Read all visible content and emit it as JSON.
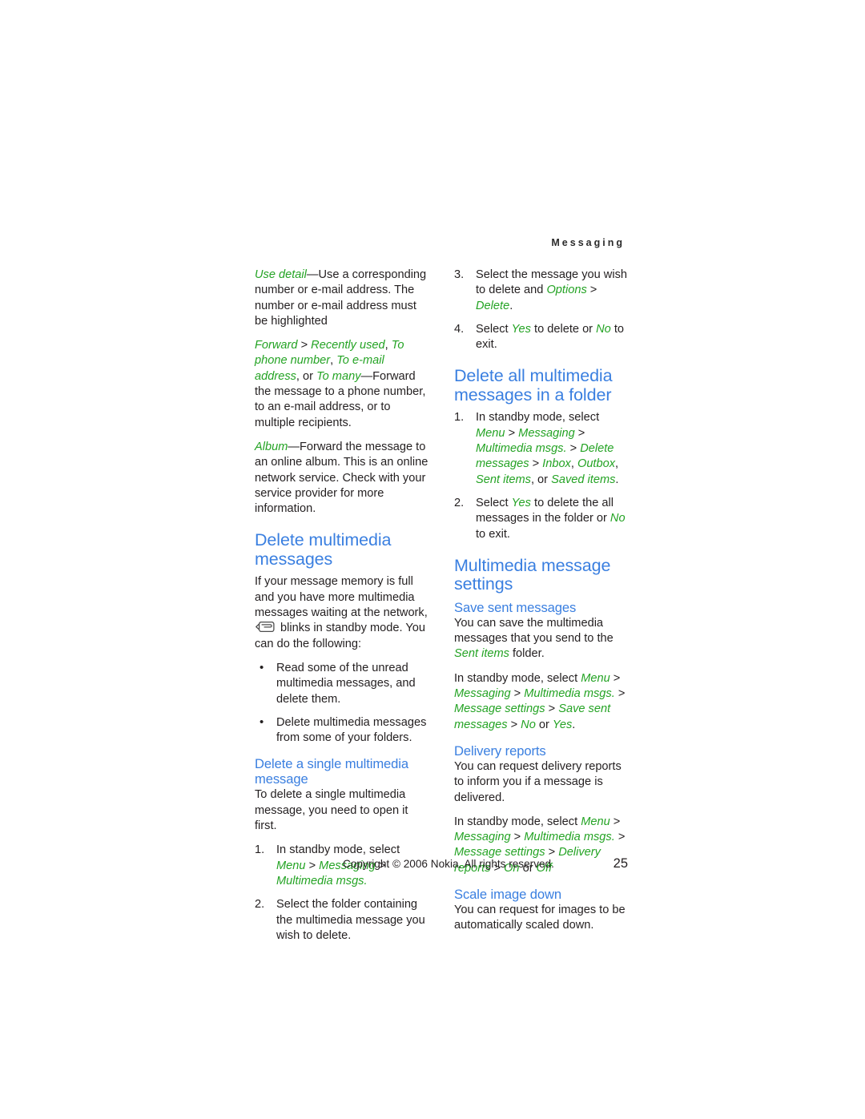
{
  "page": {
    "running_head": "Messaging",
    "page_number": "25",
    "copyright": "Copyright © 2006 Nokia. All rights reserved.",
    "colors": {
      "heading_blue": "#3a7fe0",
      "ui_string_green": "#24a324",
      "body_text": "#231f20",
      "background": "#ffffff"
    }
  },
  "left_column": {
    "paragraphs": [
      {
        "id": "use-detail",
        "runs": [
          {
            "text": "Use detail",
            "style": "green-italic"
          },
          {
            "text": "—Use a corresponding number or e-mail address. The number or e-mail address must be highlighted",
            "style": "body"
          }
        ]
      },
      {
        "id": "forward",
        "runs": [
          {
            "text": "Forward",
            "style": "green-italic"
          },
          {
            "text": " > ",
            "style": "body"
          },
          {
            "text": "Recently used",
            "style": "green-italic"
          },
          {
            "text": ", ",
            "style": "body"
          },
          {
            "text": "To phone number",
            "style": "green-italic"
          },
          {
            "text": ", ",
            "style": "body"
          },
          {
            "text": "To e-mail address",
            "style": "green-italic"
          },
          {
            "text": ", or ",
            "style": "body"
          },
          {
            "text": "To many",
            "style": "green-italic"
          },
          {
            "text": "—Forward the message to a phone number, to an e-mail address, or to multiple recipients.",
            "style": "body"
          }
        ]
      },
      {
        "id": "album",
        "runs": [
          {
            "text": "Album",
            "style": "green-italic"
          },
          {
            "text": "—Forward the message to an online album. This is an online network service. Check with your service provider for more information.",
            "style": "body"
          }
        ]
      }
    ],
    "delete_multimedia_messages": {
      "heading": "Delete multimedia messages",
      "intro_before_icon": "If your message memory is full and you have more multimedia messages waiting at the network, ",
      "icon": "message-envelope-icon",
      "intro_after_icon": " blinks in standby mode. You can do the following:",
      "bullets": [
        "Read some of the unread multimedia messages, and delete them.",
        "Delete multimedia messages from some of your folders."
      ]
    },
    "delete_single_multimedia_message": {
      "heading": "Delete a single multimedia message",
      "intro": "To delete a single multimedia message, you need to open it first.",
      "steps": [
        {
          "num": "1.",
          "runs": [
            {
              "text": "In standby mode, select ",
              "style": "body"
            },
            {
              "text": "Menu",
              "style": "green-italic"
            },
            {
              "text": " > ",
              "style": "body"
            },
            {
              "text": "Messaging",
              "style": "green-italic"
            },
            {
              "text": " > ",
              "style": "body"
            },
            {
              "text": "Multimedia msgs.",
              "style": "green-italic"
            }
          ]
        },
        {
          "num": "2.",
          "runs": [
            {
              "text": "Select the folder containing the multimedia message you wish to delete.",
              "style": "body"
            }
          ]
        }
      ]
    }
  },
  "right_column": {
    "continued_steps": [
      {
        "num": "3.",
        "runs": [
          {
            "text": "Select the message you wish to delete and ",
            "style": "body"
          },
          {
            "text": "Options",
            "style": "green-italic"
          },
          {
            "text": " > ",
            "style": "body"
          },
          {
            "text": "Delete",
            "style": "green-italic"
          },
          {
            "text": ".",
            "style": "body"
          }
        ]
      },
      {
        "num": "4.",
        "runs": [
          {
            "text": "Select ",
            "style": "body"
          },
          {
            "text": "Yes",
            "style": "green-italic"
          },
          {
            "text": " to delete or ",
            "style": "body"
          },
          {
            "text": "No",
            "style": "green-italic"
          },
          {
            "text": " to exit.",
            "style": "body"
          }
        ]
      }
    ],
    "delete_all_in_folder": {
      "heading": "Delete all multimedia messages in a folder",
      "steps": [
        {
          "num": "1.",
          "runs": [
            {
              "text": "In standby mode, select ",
              "style": "body"
            },
            {
              "text": "Menu",
              "style": "green-italic"
            },
            {
              "text": " > ",
              "style": "body"
            },
            {
              "text": "Messaging",
              "style": "green-italic"
            },
            {
              "text": " > ",
              "style": "body"
            },
            {
              "text": "Multimedia msgs.",
              "style": "green-italic"
            },
            {
              "text": " > ",
              "style": "body"
            },
            {
              "text": "Delete messages",
              "style": "green-italic"
            },
            {
              "text": " > ",
              "style": "body"
            },
            {
              "text": "Inbox",
              "style": "green-italic"
            },
            {
              "text": ", ",
              "style": "body"
            },
            {
              "text": "Outbox",
              "style": "green-italic"
            },
            {
              "text": ", ",
              "style": "body"
            },
            {
              "text": "Sent items",
              "style": "green-italic"
            },
            {
              "text": ", or ",
              "style": "body"
            },
            {
              "text": "Saved items",
              "style": "green-italic"
            },
            {
              "text": ".",
              "style": "body"
            }
          ]
        },
        {
          "num": "2.",
          "runs": [
            {
              "text": "Select ",
              "style": "body"
            },
            {
              "text": "Yes",
              "style": "green-italic"
            },
            {
              "text": " to delete the all messages in the folder or ",
              "style": "body"
            },
            {
              "text": "No",
              "style": "green-italic"
            },
            {
              "text": " to exit.",
              "style": "body"
            }
          ]
        }
      ]
    },
    "multimedia_message_settings": {
      "heading": "Multimedia message settings",
      "save_sent_messages": {
        "heading": "Save sent messages",
        "body_runs": [
          {
            "text": "You can save the multimedia messages that you send to the ",
            "style": "body"
          },
          {
            "text": "Sent items",
            "style": "green-italic"
          },
          {
            "text": " folder.",
            "style": "body"
          }
        ],
        "path_runs": [
          {
            "text": "In standby mode, select ",
            "style": "body"
          },
          {
            "text": "Menu",
            "style": "green-italic"
          },
          {
            "text": " > ",
            "style": "body"
          },
          {
            "text": "Messaging",
            "style": "green-italic"
          },
          {
            "text": " > ",
            "style": "body"
          },
          {
            "text": "Multimedia msgs.",
            "style": "green-italic"
          },
          {
            "text": " > ",
            "style": "body"
          },
          {
            "text": "Message settings",
            "style": "green-italic"
          },
          {
            "text": " > ",
            "style": "body"
          },
          {
            "text": "Save sent messages",
            "style": "green-italic"
          },
          {
            "text": " > ",
            "style": "body"
          },
          {
            "text": "No",
            "style": "green-italic"
          },
          {
            "text": " or ",
            "style": "body"
          },
          {
            "text": "Yes",
            "style": "green-italic"
          },
          {
            "text": ".",
            "style": "body"
          }
        ]
      },
      "delivery_reports": {
        "heading": "Delivery reports",
        "body": "You can request delivery reports to inform you if a message is delivered.",
        "path_runs": [
          {
            "text": "In standby mode, select ",
            "style": "body"
          },
          {
            "text": "Menu",
            "style": "green-italic"
          },
          {
            "text": " > ",
            "style": "body"
          },
          {
            "text": "Messaging",
            "style": "green-italic"
          },
          {
            "text": " > ",
            "style": "body"
          },
          {
            "text": "Multimedia msgs.",
            "style": "green-italic"
          },
          {
            "text": " > ",
            "style": "body"
          },
          {
            "text": "Message settings",
            "style": "green-italic"
          },
          {
            "text": " > ",
            "style": "body"
          },
          {
            "text": "Delivery reports",
            "style": "green-italic"
          },
          {
            "text": " > ",
            "style": "body"
          },
          {
            "text": "On",
            "style": "green-italic"
          },
          {
            "text": " or ",
            "style": "body"
          },
          {
            "text": "Off",
            "style": "green-italic"
          }
        ]
      },
      "scale_image_down": {
        "heading": "Scale image down",
        "body": "You can request for images to be automatically scaled down."
      }
    }
  }
}
